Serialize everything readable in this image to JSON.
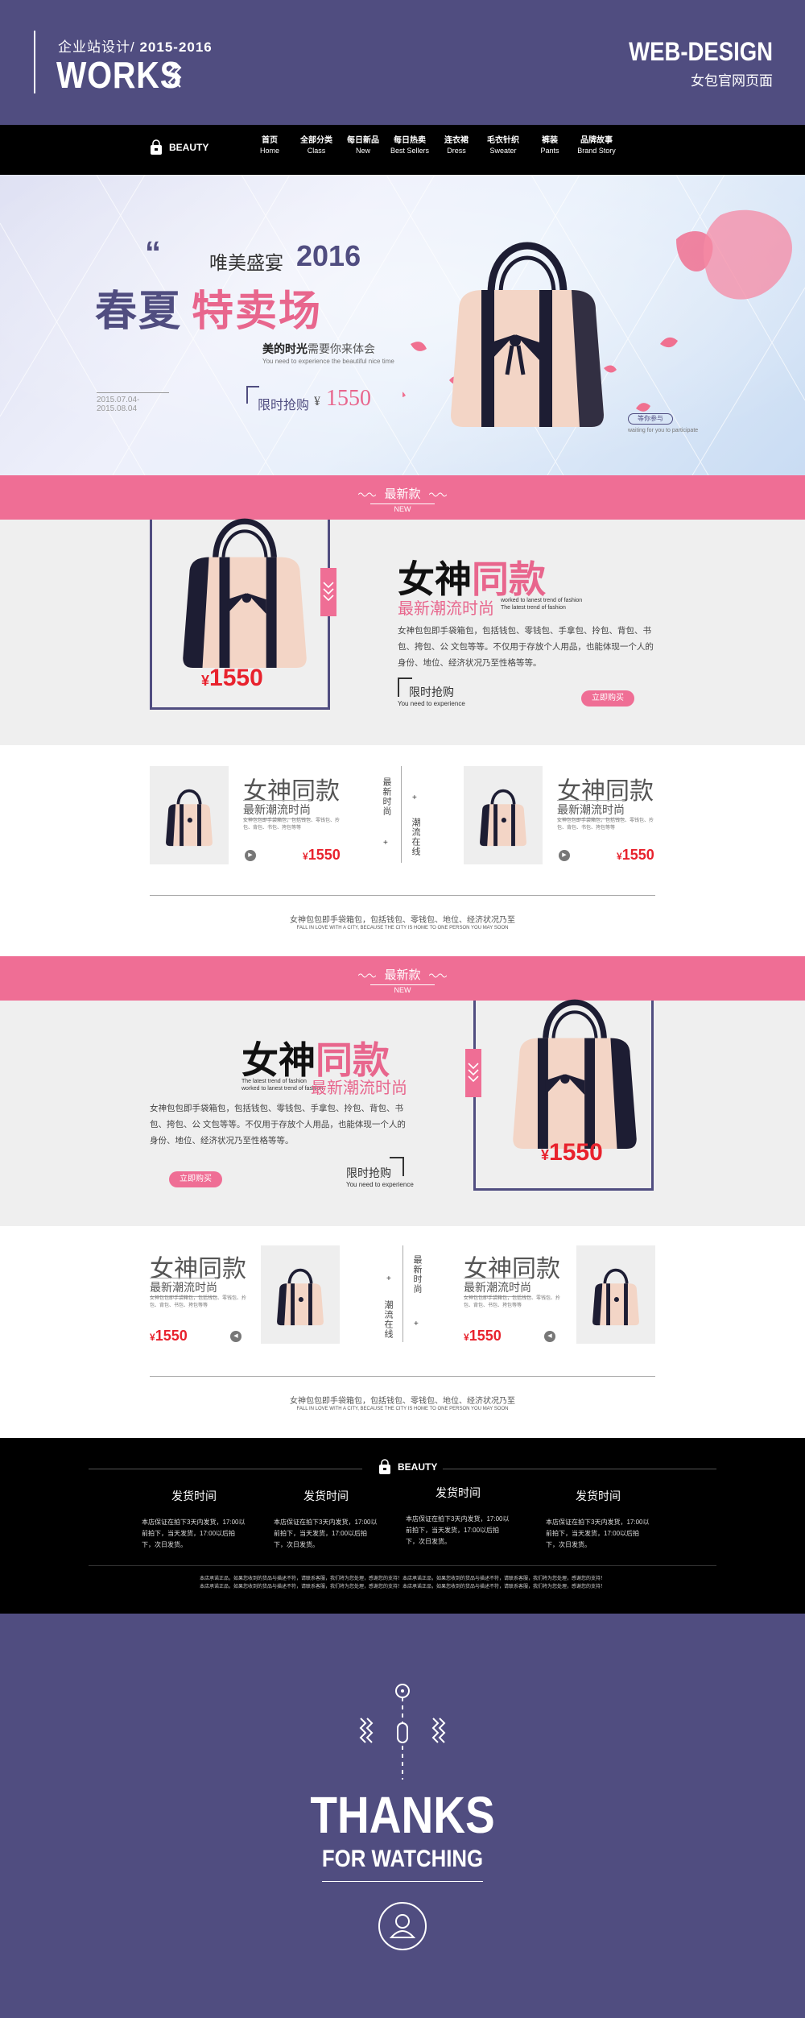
{
  "header": {
    "subtitle": "企业站设计/",
    "years": "2015-2016",
    "title": "WORKS",
    "right_title": "WEB-DESIGN",
    "right_sub": "女包官网页面",
    "bg_color": "#504d80"
  },
  "nav": {
    "logo": "BEAUTY",
    "items": [
      {
        "cn": "首页",
        "en": "Home"
      },
      {
        "cn": "全部分类",
        "en": "Class"
      },
      {
        "cn": "每日新品",
        "en": "New"
      },
      {
        "cn": "每日热卖",
        "en": "Best Sellers"
      },
      {
        "cn": "连衣裙",
        "en": "Dress"
      },
      {
        "cn": "毛衣针织",
        "en": "Sweater"
      },
      {
        "cn": "裤装",
        "en": "Pants"
      },
      {
        "cn": "品牌故事",
        "en": "Brand Story"
      }
    ]
  },
  "banner": {
    "line1": "唯美盛宴",
    "year": "2016",
    "title_a": "春夏",
    "title_b": "特卖场",
    "tag_a": "美的时光",
    "tag_b": "需要你来体会",
    "tag_en": "You need to experience the beautiful nice time",
    "date": "2015.07.04-2015.08.04",
    "limit": "限时抢购",
    "currency": "¥",
    "price": "1550",
    "button": "等你参与",
    "button_sub": "waiting for you to participate"
  },
  "section1": {
    "bar_title": "最新款",
    "bar_sub": "NEW",
    "price_currency": "¥",
    "price": "1550",
    "title_a": "女神",
    "title_b": "同款",
    "subtitle": "最新潮流时尚",
    "small_en1": "worked to lanest trend of fashion",
    "small_en2": "The latest trend of fashion",
    "desc": "女神包包即手袋箱包，包括钱包、零钱包、手拿包、拎包、背包、书包、挎包、公 文包等等。不仅用于存放个人用品，也能体现一个人的身份、地位、经济状况乃至性格等等。",
    "limit": "限时抢购",
    "limit_sub": "You need to experience",
    "button": "立即购买"
  },
  "products1": {
    "vlabel_a": "最新时尚",
    "vlabel_b": "潮流在线",
    "items": [
      {
        "title": "女神同款",
        "sub": "最新潮流时尚",
        "small": "女神包包即手袋箱包，包括钱包、零钱包、拎包、背包、书包、挎包等等",
        "currency": "¥",
        "price": "1550"
      },
      {
        "title": "女神同款",
        "sub": "最新潮流时尚",
        "small": "女神包包即手袋箱包，包括钱包、零钱包、拎包、背包、书包、挎包等等",
        "currency": "¥",
        "price": "1550"
      }
    ],
    "footer_cn": "女神包包即手袋箱包，包括钱包、零钱包、地位、经济状况乃至",
    "footer_en": "FALL IN LOVE WITH A CITY, BECAUSE THE CITY IS HOME TO ONE PERSON YOU MAY SOON"
  },
  "section2": {
    "bar_title": "最新款",
    "bar_sub": "NEW",
    "price_currency": "¥",
    "price": "1550",
    "title_a": "女神",
    "title_b": "同款",
    "subtitle": "最新潮流时尚",
    "small_en1": "The latest trend of fashion",
    "small_en2": "worked to lanest trend of fashion",
    "desc": "女神包包即手袋箱包，包括钱包、零钱包、手拿包、拎包、背包、书包、挎包、公 文包等等。不仅用于存放个人用品，也能体现一个人的身份、地位、经济状况乃至性格等等。",
    "limit": "限时抢购",
    "limit_sub": "You need to experience",
    "button": "立即购买"
  },
  "products2": {
    "vlabel_a": "最新时尚",
    "vlabel_b": "潮流在线",
    "items": [
      {
        "title": "女神同款",
        "sub": "最新潮流时尚",
        "small": "女神包包即手袋箱包，包括钱包、零钱包、拎包、背包、书包、挎包等等",
        "currency": "¥",
        "price": "1550"
      },
      {
        "title": "女神同款",
        "sub": "最新潮流时尚",
        "small": "女神包包即手袋箱包，包括钱包、零钱包、拎包、背包、书包、挎包等等",
        "currency": "¥",
        "price": "1550"
      }
    ],
    "footer_cn": "女神包包即手袋箱包，包括钱包、零钱包、地位、经济状况乃至",
    "footer_en": "FALL IN LOVE WITH A CITY, BECAUSE THE CITY IS HOME TO ONE PERSON YOU MAY SOON"
  },
  "footer": {
    "logo": "BEAUTY",
    "columns": [
      {
        "title": "发货时间",
        "text": "本店保证在拍下3天内发货，17:00以前拍下，当天发货，17:00以后拍下，次日发货。"
      },
      {
        "title": "发货时间",
        "text": "本店保证在拍下3天内发货，17:00以前拍下，当天发货，17:00以后拍下，次日发货。"
      },
      {
        "title": "发货时间",
        "text": "本店保证在拍下3天内发货，17:00以前拍下，当天发货，17:00以后拍下，次日发货。"
      },
      {
        "title": "发货时间",
        "text": "本店保证在拍下3天内发货，17:00以前拍下，当天发货，17:00以后拍下，次日发货。"
      }
    ],
    "note1": "本店承诺正品，如果您收到的货品与描述不符，请联系客服，我们将为您处理，感谢您的支持！本店承诺正品，如果您收到的货品与描述不符，请联系客服，我们将为您处理，感谢您的支持！",
    "note2": "本店承诺正品，如果您收到的货品与描述不符，请联系客服，我们将为您处理，感谢您的支持！本店承诺正品，如果您收到的货品与描述不符，请联系客服，我们将为您处理，感谢您的支持！"
  },
  "thanks": {
    "line1": "THANKS",
    "line2": "FOR WATCHING"
  },
  "colors": {
    "purple": "#504d80",
    "pink": "#ef6e95",
    "red_price": "#e8222d",
    "light_gray": "#efefef"
  },
  "icons": [
    "zigzag-icon",
    "bag-logo-icon",
    "handbag-image",
    "petal-decoration",
    "play-icon",
    "user-icon"
  ]
}
